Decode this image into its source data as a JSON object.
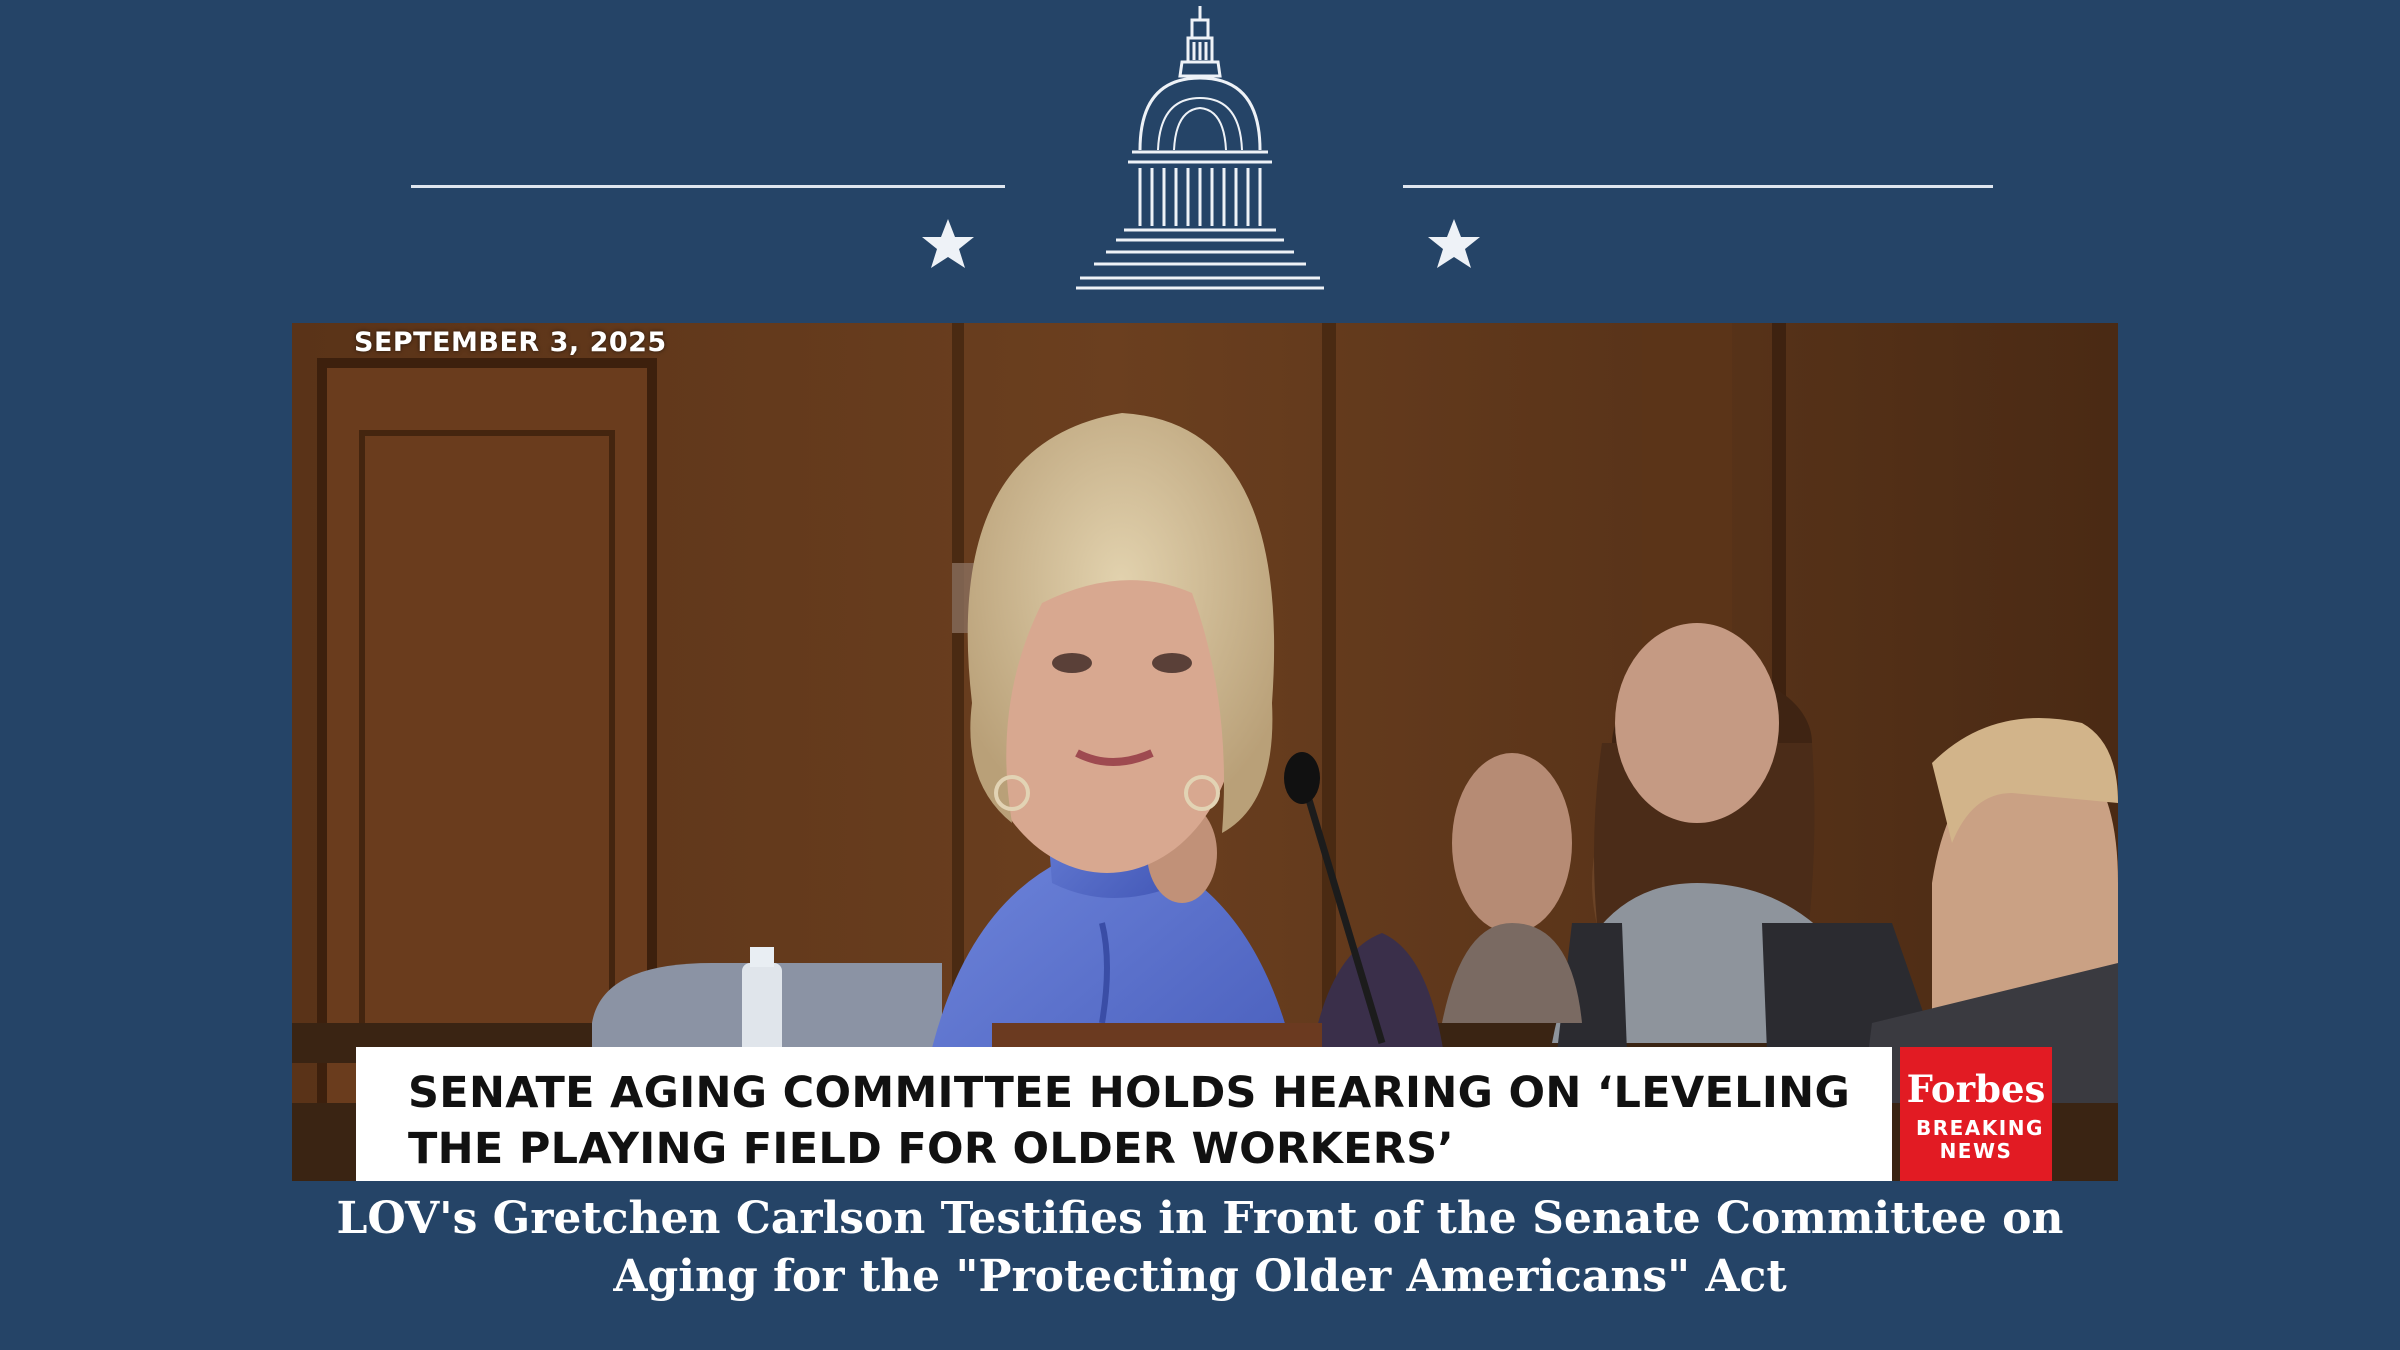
{
  "header": {
    "emblem_icon": "capitol-dome-icon",
    "star_icon": "star-icon"
  },
  "video": {
    "date_stamp": "SEPTEMBER 3, 2025",
    "lower_third": {
      "headline": "SENATE AGING COMMITTEE HOLDS HEARING ON ‘LEVELING THE PLAYING FIELD FOR OLDER WORKERS’"
    },
    "badge": {
      "logo": "Forbes",
      "tag": "BREAKING NEWS",
      "color": "#e21b23"
    }
  },
  "caption": {
    "text": "LOV's Gretchen Carlson Testifies in Front of the Senate Committee on Aging for the \"Protecting Older Americans\" Act"
  },
  "colors": {
    "background": "#254467",
    "accent": "#dfe6ef"
  }
}
